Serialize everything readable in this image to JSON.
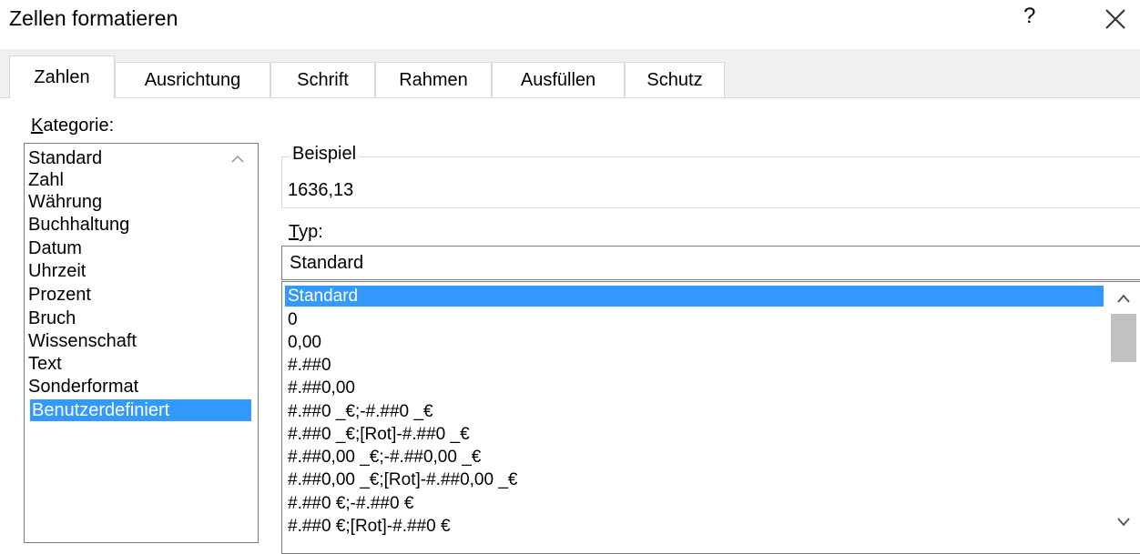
{
  "dialog": {
    "title": "Zellen formatieren",
    "help": "?"
  },
  "tabs": [
    "Zahlen",
    "Ausrichtung",
    "Schrift",
    "Rahmen",
    "Ausfüllen",
    "Schutz"
  ],
  "category": {
    "label_first": "K",
    "label_rest": "ategorie:",
    "items": [
      "Standard",
      "Zahl",
      "Währung",
      "Buchhaltung",
      "Datum",
      "Uhrzeit",
      "Prozent",
      "Bruch",
      "Wissenschaft",
      "Text",
      "Sonderformat",
      "Benutzerdefiniert"
    ],
    "selected": "Benutzerdefiniert"
  },
  "sample": {
    "legend": "Beispiel",
    "value": "1636,13"
  },
  "type": {
    "label_first": "T",
    "label_rest": "yp:",
    "value": "Standard",
    "formats": [
      "Standard",
      "0",
      "0,00",
      "#.##0",
      "#.##0,00",
      "#.##0 _€;-#.##0 _€",
      "#.##0 _€;[Rot]-#.##0 _€",
      "#.##0,00 _€;-#.##0,00 _€",
      "#.##0,00 _€;[Rot]-#.##0,00 _€",
      "#.##0 €;-#.##0 €",
      "#.##0 €;[Rot]-#.##0 €"
    ],
    "selected": "Standard"
  },
  "colors": {
    "selection": "#3399ff",
    "tab_band": "#f0f0f0"
  }
}
